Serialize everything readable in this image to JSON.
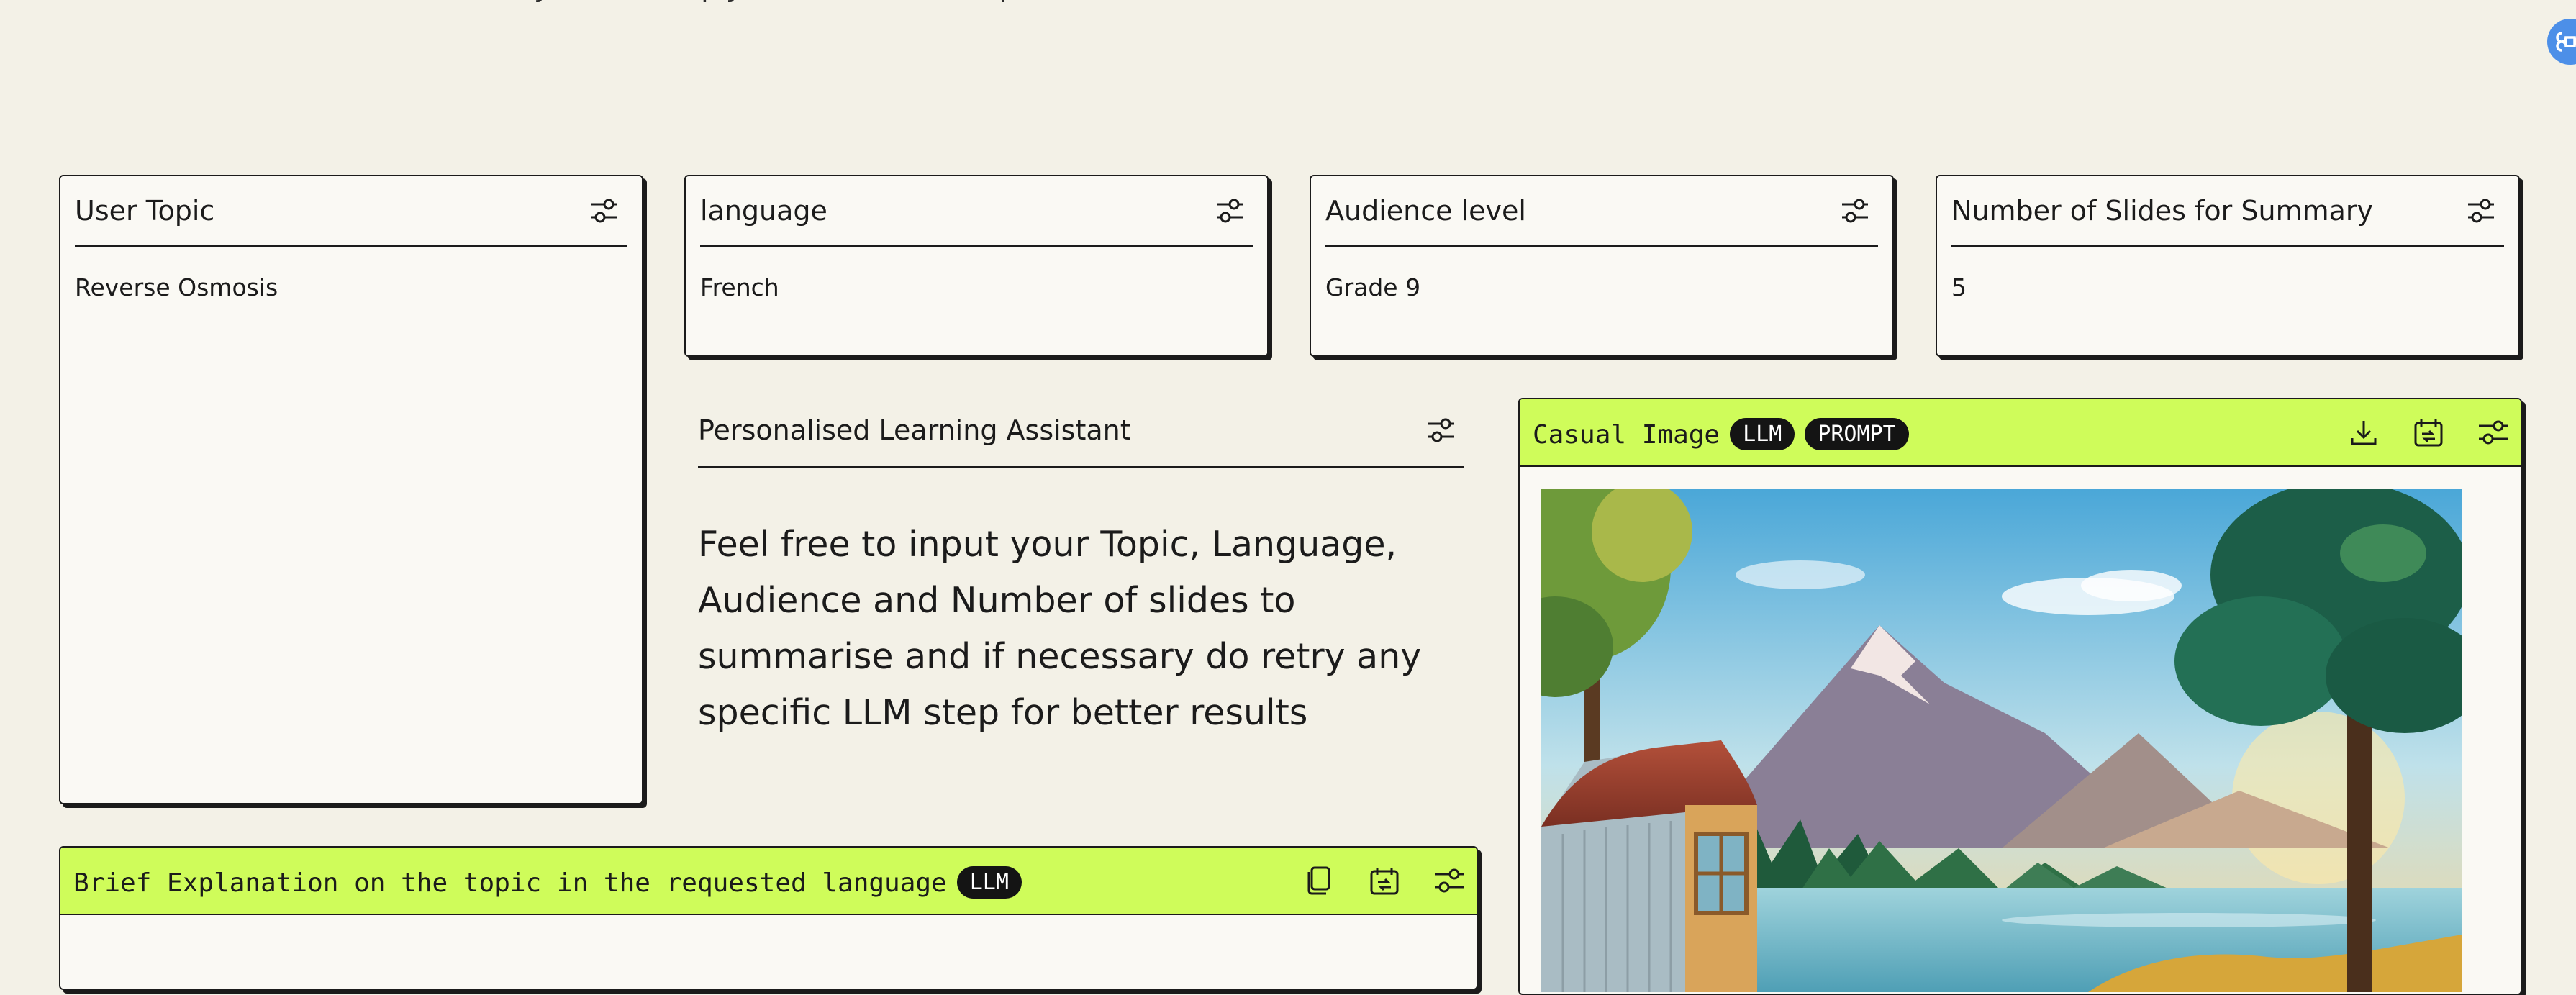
{
  "header": {
    "partial_text": "…ny … a…d … ply … …ch … … … … p…"
  },
  "inputs": [
    {
      "label": "User Topic",
      "value": "Reverse Osmosis"
    },
    {
      "label": "language",
      "value": "French"
    },
    {
      "label": "Audience level",
      "value": "Grade 9"
    },
    {
      "label": "Number of Slides for Summary",
      "value": "5"
    }
  ],
  "assistant": {
    "title": "Personalised Learning Assistant",
    "description": "Feel free to input your Topic, Language, Audience and Number of slides to summarise and if necessary do retry any specific LLM step for better results"
  },
  "explanation_node": {
    "title": "Brief Explanation on the topic in the requested language",
    "badges": [
      "LLM"
    ]
  },
  "image_node": {
    "title": "Casual Image",
    "badges": [
      "LLM",
      "PROMPT"
    ]
  },
  "icons": {
    "settings": "sliders-icon",
    "copy": "copy-icon",
    "retry": "retry-icon",
    "download": "download-icon",
    "corner": "command-icon"
  },
  "colors": {
    "background": "#f3f1e7",
    "node_header": "#cffc5a",
    "badge": "#141414"
  }
}
